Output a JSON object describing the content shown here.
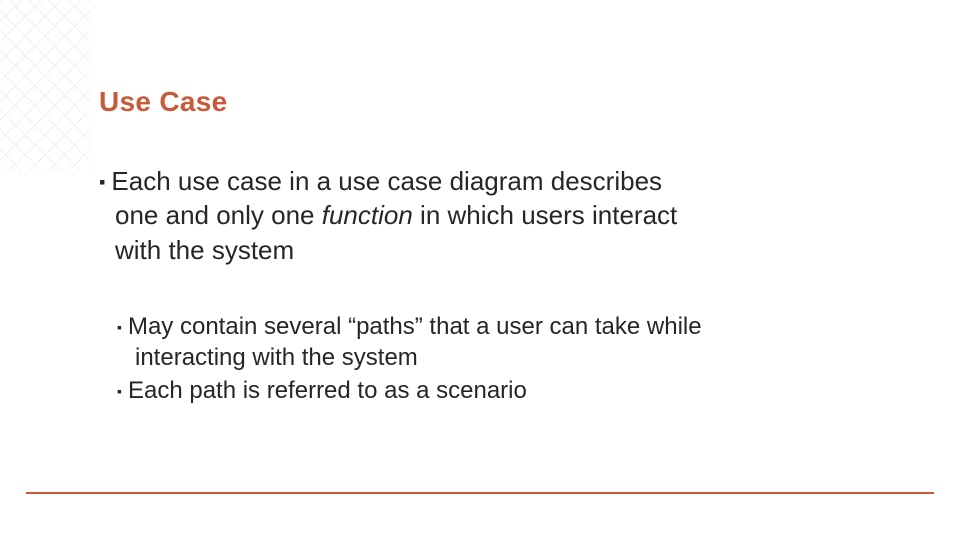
{
  "title": "Use Case",
  "bullet_glyph": "▪",
  "l1": {
    "line1": "Each use case in a use case diagram describes",
    "line2_pre": "one and only one ",
    "line2_em": "function",
    "line2_post": " in which users interact",
    "line3": "with the system"
  },
  "l2a": {
    "line1": "May contain several “paths” that a user can take while",
    "line2": "interacting with the system"
  },
  "l2b": {
    "line1": "Each path is referred to as a scenario"
  }
}
